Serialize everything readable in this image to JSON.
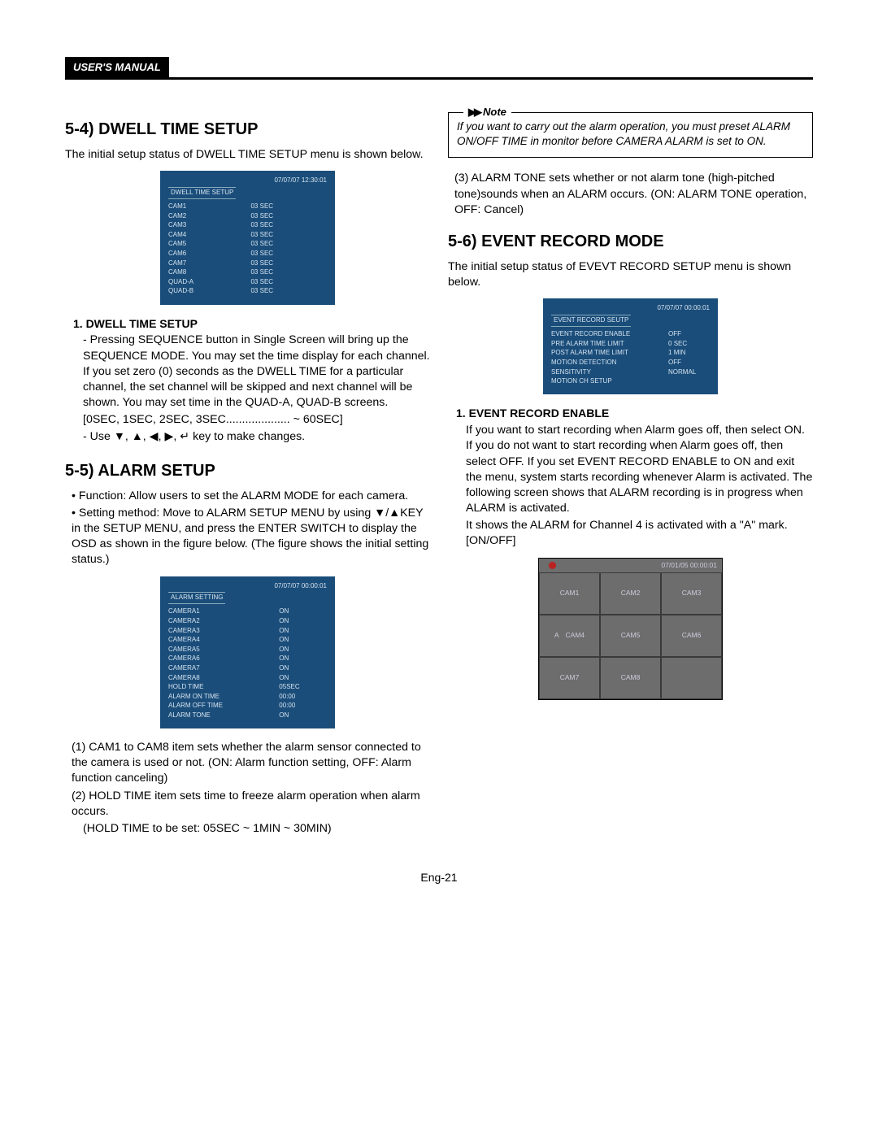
{
  "header": {
    "label": "USER'S MANUAL"
  },
  "left": {
    "s54_title": "5-4) DWELL TIME SETUP",
    "s54_intro": "The initial setup status of DWELL TIME SETUP menu is shown below.",
    "osd_dwell": {
      "timestamp": "07/07/07  12:30:01",
      "title": "DWELL TIME SETUP",
      "rows": [
        {
          "k": "CAM1",
          "v": "03 SEC"
        },
        {
          "k": "CAM2",
          "v": "03 SEC"
        },
        {
          "k": "CAM3",
          "v": "03 SEC"
        },
        {
          "k": "CAM4",
          "v": "03 SEC"
        },
        {
          "k": "CAM5",
          "v": "03 SEC"
        },
        {
          "k": "CAM6",
          "v": "03 SEC"
        },
        {
          "k": "CAM7",
          "v": "03 SEC"
        },
        {
          "k": "CAM8",
          "v": "03 SEC"
        },
        {
          "k": "QUAD-A",
          "v": "03 SEC"
        },
        {
          "k": "QUAD-B",
          "v": "03 SEC"
        }
      ]
    },
    "s54_sub": "1. DWELL TIME SETUP",
    "s54_p1": "- Pressing SEQUENCE button in Single Screen will bring up the SEQUENCE MODE. You may set the time display for each channel. If you set zero (0) seconds as the DWELL TIME for a particular channel, the set channel will be skipped and next channel will be shown. You may set time in the QUAD-A, QUAD-B screens.",
    "s54_p2": "[0SEC, 1SEC, 2SEC, 3SEC.................... ~ 60SEC]",
    "s54_p3": "- Use ▼, ▲, ◀, ▶, ↵ key to make changes.",
    "s55_title": "5-5) ALARM SETUP",
    "s55_b1": "• Function: Allow users to set the ALARM MODE for each camera.",
    "s55_b2": "• Setting method: Move to ALARM SETUP MENU by using ▼/▲KEY in the SETUP MENU, and press the ENTER SWITCH to display the OSD as shown in the figure below. (The figure shows the initial setting status.)",
    "osd_alarm": {
      "timestamp": "07/07/07  00:00:01",
      "title": "ALARM   SETTING",
      "rows": [
        {
          "k": "CAMERA1",
          "v": "ON"
        },
        {
          "k": "CAMERA2",
          "v": "ON"
        },
        {
          "k": "CAMERA3",
          "v": "ON"
        },
        {
          "k": "CAMERA4",
          "v": "ON"
        },
        {
          "k": "CAMERA5",
          "v": "ON"
        },
        {
          "k": "CAMERA6",
          "v": "ON"
        },
        {
          "k": "CAMERA7",
          "v": "ON"
        },
        {
          "k": "CAMERA8",
          "v": "ON"
        },
        {
          "k": "HOLD TIME",
          "v": "05SEC"
        },
        {
          "k": "ALARM ON TIME",
          "v": "00:00"
        },
        {
          "k": "ALARM OFF TIME",
          "v": "00:00"
        },
        {
          "k": "ALARM TONE",
          "v": "ON"
        }
      ]
    },
    "s55_n1": "(1) CAM1 to CAM8 item sets whether the alarm sensor connected to the camera is used or not. (ON: Alarm function setting, OFF: Alarm function canceling)",
    "s55_n2": "(2) HOLD TIME item sets time to freeze alarm operation when alarm occurs.",
    "s55_n2b": "(HOLD TIME to be set: 05SEC ~ 1MIN ~ 30MIN)"
  },
  "right": {
    "note_label": "Note",
    "note_body": "If you want to carry out the alarm operation, you must preset ALARM ON/OFF TIME in monitor before CAMERA ALARM is set to ON.",
    "s55_n3": "(3) ALARM TONE sets whether or not alarm tone (high-pitched tone)sounds when an ALARM occurs. (ON: ALARM TONE operation, OFF: Cancel)",
    "s56_title": "5-6) EVENT RECORD MODE",
    "s56_intro": "The initial setup status of EVEVT RECORD SETUP menu is shown below.",
    "osd_event": {
      "timestamp": "07/07/07  00:00:01",
      "title": "EVENT RECORD SEUTP",
      "rows": [
        {
          "k": "EVENT RECORD ENABLE",
          "v": "OFF"
        },
        {
          "k": "PRE ALARM TIME LIMIT",
          "v": "0 SEC"
        },
        {
          "k": "POST ALARM TIME LIMIT",
          "v": "1 MIN"
        },
        {
          "k": "MOTION DETECTION",
          "v": "OFF"
        },
        {
          "k": "SENSITIVITY",
          "v": "NORMAL"
        },
        {
          "k": "MOTION CH SETUP",
          "v": ""
        }
      ]
    },
    "s56_sub": "1. EVENT RECORD ENABLE",
    "s56_p1": "If you want to start recording when Alarm goes off, then select ON. If you do not want to start recording when Alarm goes off, then select OFF.  If you set EVENT RECORD ENABLE to ON and exit the menu, system starts recording whenever Alarm is activated. The following screen shows that ALARM recording is in progress when ALARM is activated.",
    "s56_p2": "It shows the ALARM for Channel 4 is activated with a \"A\" mark. [ON/OFF]",
    "camgrid": {
      "timestamp": "07/01/05  00:00:01",
      "cells": [
        "CAM1",
        "CAM2",
        "CAM3",
        "CAM4",
        "CAM5",
        "CAM6",
        "CAM7",
        "CAM8",
        ""
      ]
    }
  },
  "pagenum": "Eng-21"
}
